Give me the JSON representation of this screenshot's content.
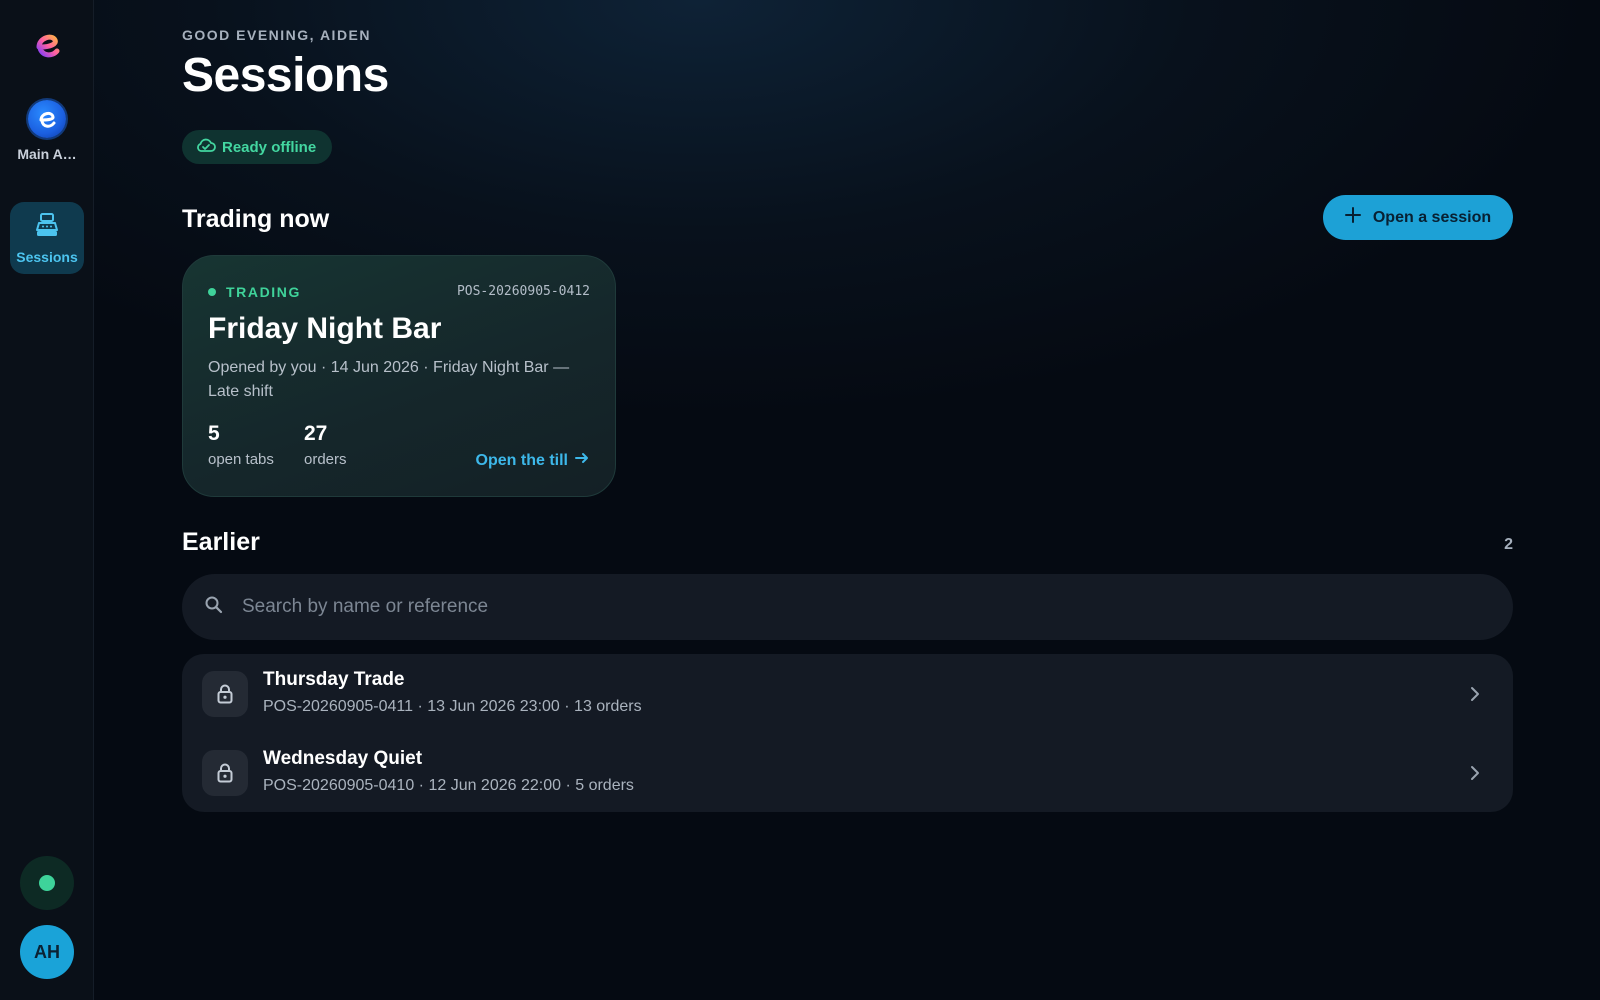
{
  "sidebar": {
    "brand_icon": "brand-e-logo",
    "account": {
      "label": "Main A…",
      "icon": "account-e-logo"
    },
    "nav": [
      {
        "label": "Sessions",
        "icon": "cash-register-icon",
        "active": true
      }
    ],
    "status_icon": "online-status-dot",
    "avatar_initials": "AH"
  },
  "header": {
    "greeting": "GOOD EVENING, AIDEN",
    "title": "Sessions",
    "badge": {
      "label": "Ready offline",
      "icon": "cloud-check-icon"
    }
  },
  "trading": {
    "section_title": "Trading now",
    "open_button": "Open a session",
    "card": {
      "status": "TRADING",
      "reference": "POS-20260905-0412",
      "name": "Friday Night Bar",
      "meta": "Opened by you · 14 Jun 2026 · Friday Night Bar — Late shift",
      "stats": [
        {
          "value": "5",
          "label": "open tabs"
        },
        {
          "value": "27",
          "label": "orders"
        }
      ],
      "action": "Open the till"
    }
  },
  "earlier": {
    "section_title": "Earlier",
    "count": "2",
    "search_placeholder": "Search by name or reference",
    "sessions": [
      {
        "name": "Thursday Trade",
        "meta": "POS-20260905-0411 · 13 Jun 2026 23:00 · 13 orders"
      },
      {
        "name": "Wednesday Quiet",
        "meta": "POS-20260905-0410 · 12 Jun 2026 22:00 · 5 orders"
      }
    ]
  },
  "colors": {
    "accent": "#1da1d6",
    "trading_green": "#3fd39a",
    "background": "#08111c"
  }
}
